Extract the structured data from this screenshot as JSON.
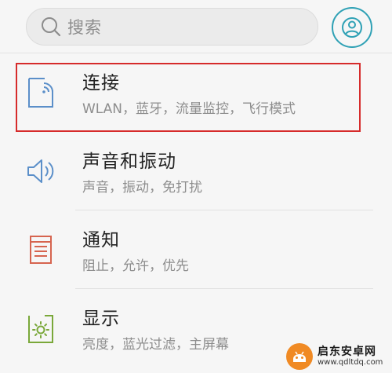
{
  "search": {
    "placeholder": "搜索"
  },
  "colors": {
    "accent": "#2fa1b5",
    "highlight": "#d62b2b",
    "icon_line": "#5b8fc9",
    "notify_icon": "#d6644f",
    "display_icon": "#7aa83a"
  },
  "settings": {
    "items": [
      {
        "title": "连接",
        "subtitle": "WLAN，蓝牙，流量监控，飞行模式",
        "icon": "connection-icon"
      },
      {
        "title": "声音和振动",
        "subtitle": "声音，振动，免打扰",
        "icon": "speaker-icon"
      },
      {
        "title": "通知",
        "subtitle": "阻止，允许，优先",
        "icon": "notification-icon"
      },
      {
        "title": "显示",
        "subtitle": "亮度，蓝光过滤，主屏幕",
        "icon": "display-icon"
      }
    ]
  },
  "watermark": {
    "name": "启东安卓网",
    "url": "www.qdltdq.com"
  }
}
